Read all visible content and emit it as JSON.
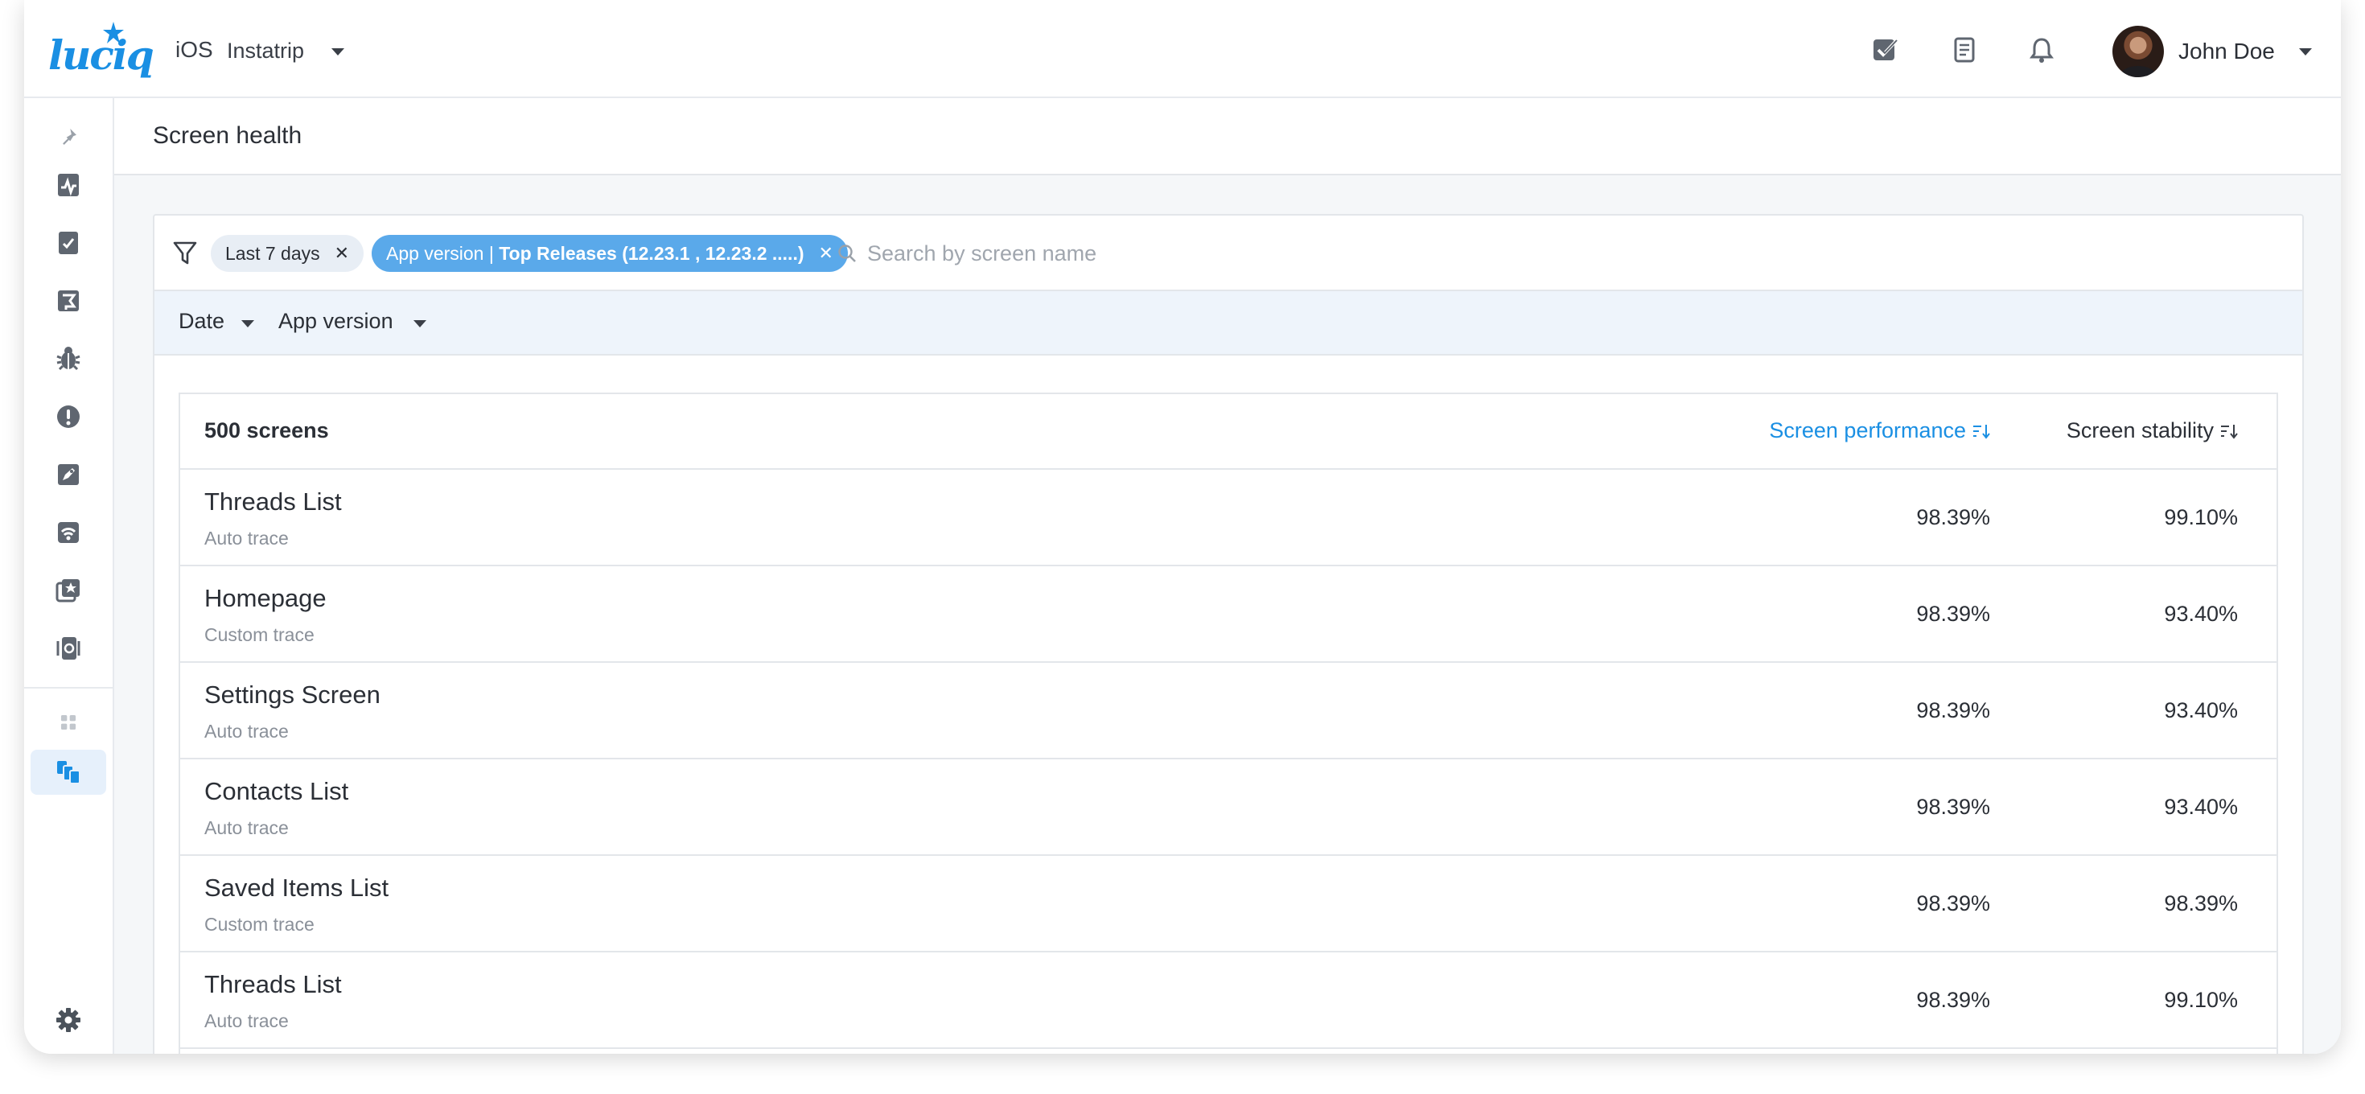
{
  "header": {
    "logo_text": "luciq",
    "platform": "iOS",
    "app_name": "Instatrip",
    "icons": [
      "checklist-icon",
      "document-icon",
      "bell-icon"
    ],
    "user_name": "John Doe"
  },
  "sidebar": {
    "items": [
      {
        "icon": "pin-icon"
      },
      {
        "icon": "app-health-icon"
      },
      {
        "icon": "reports-icon"
      },
      {
        "icon": "flag-icon"
      },
      {
        "icon": "bug-icon"
      },
      {
        "icon": "alert-icon"
      },
      {
        "icon": "rocket-icon"
      },
      {
        "icon": "network-icon"
      },
      {
        "icon": "star-screens-icon"
      },
      {
        "icon": "session-replay-icon"
      },
      {
        "icon": "apps-grid-icon"
      },
      {
        "icon": "screens-icon",
        "active": true
      },
      {
        "icon": "gear-icon"
      }
    ],
    "accent_color": "#1a8fe3"
  },
  "page": {
    "title": "Screen health"
  },
  "filters": {
    "date_chip": "Last 7 days",
    "app_chip_prefix": "App version | ",
    "app_chip_value": "Top Releases (12.23.1 , 12.23.2 .....)",
    "search_placeholder": "Search by screen name",
    "dropdowns": [
      "Date",
      "App version"
    ]
  },
  "table": {
    "count_label": "500 screens",
    "col_performance": "Screen performance",
    "col_stability": "Screen stability",
    "rows": [
      {
        "name": "Threads List",
        "trace": "Auto trace",
        "performance": "98.39%",
        "stability": "99.10%"
      },
      {
        "name": "Homepage",
        "trace": "Custom trace",
        "performance": "98.39%",
        "stability": "93.40%"
      },
      {
        "name": "Settings Screen",
        "trace": "Auto trace",
        "performance": "98.39%",
        "stability": "93.40%"
      },
      {
        "name": "Contacts List",
        "trace": "Auto trace",
        "performance": "98.39%",
        "stability": "93.40%"
      },
      {
        "name": "Saved Items List",
        "trace": "Custom trace",
        "performance": "98.39%",
        "stability": "98.39%"
      },
      {
        "name": "Threads List",
        "trace": "Auto trace",
        "performance": "98.39%",
        "stability": "99.10%"
      }
    ]
  }
}
